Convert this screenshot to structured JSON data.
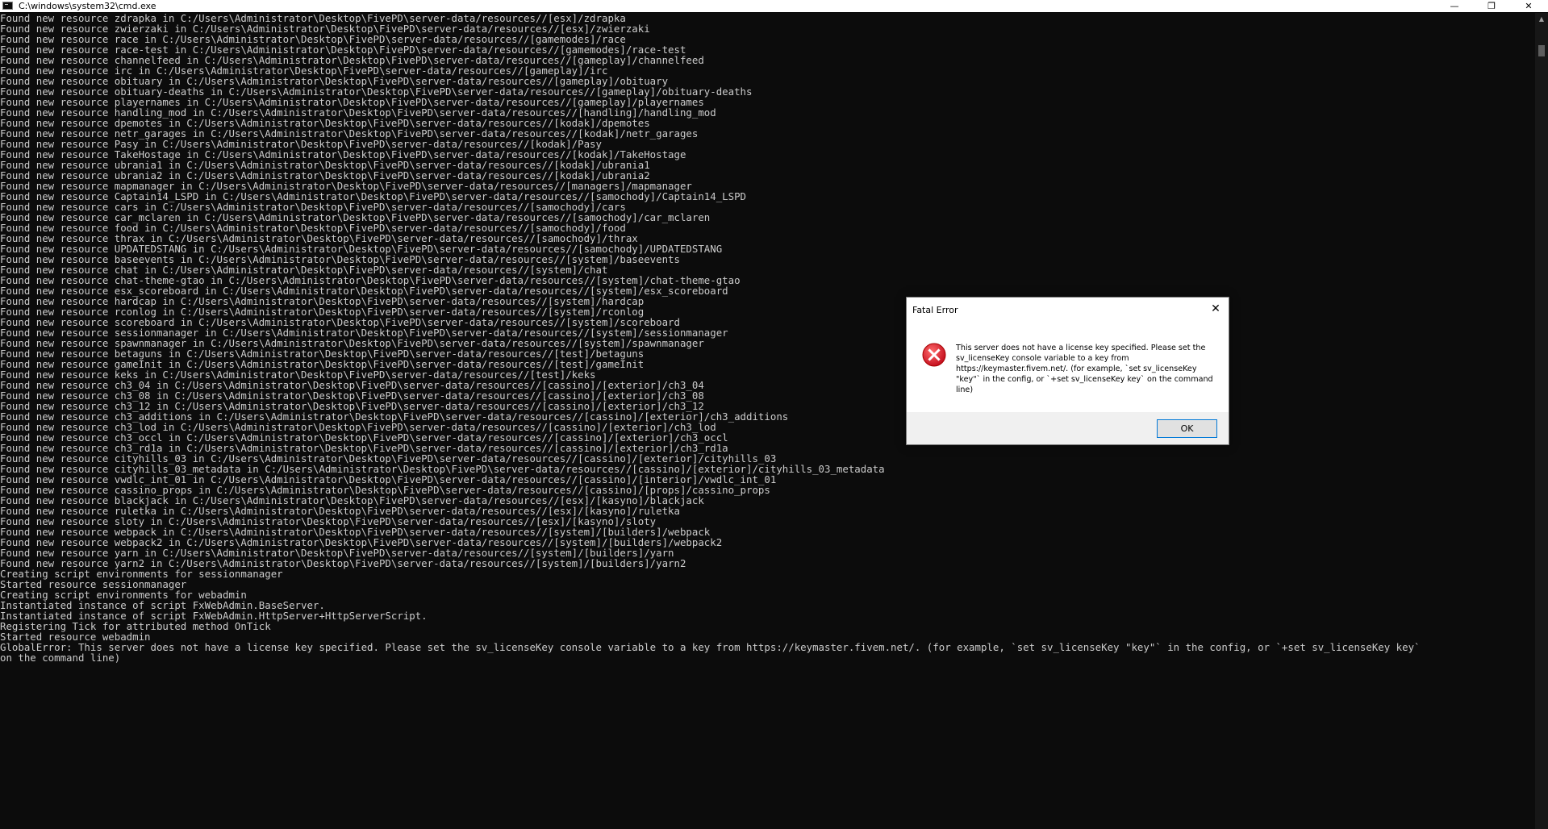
{
  "window": {
    "title": "C:\\windows\\system32\\cmd.exe",
    "minimize_glyph": "—",
    "maximize_glyph": "❐",
    "close_glyph": "✕",
    "background": "#0c0c0c",
    "text_color": "#cccccc"
  },
  "console": {
    "lines": [
      "Found new resource zdrapka in C:/Users\\Administrator\\Desktop\\FivePD\\server-data/resources//[esx]/zdrapka",
      "Found new resource zwierzaki in C:/Users\\Administrator\\Desktop\\FivePD\\server-data/resources//[esx]/zwierzaki",
      "Found new resource race in C:/Users\\Administrator\\Desktop\\FivePD\\server-data/resources//[gamemodes]/race",
      "Found new resource race-test in C:/Users\\Administrator\\Desktop\\FivePD\\server-data/resources//[gamemodes]/race-test",
      "Found new resource channelfeed in C:/Users\\Administrator\\Desktop\\FivePD\\server-data/resources//[gameplay]/channelfeed",
      "Found new resource irc in C:/Users\\Administrator\\Desktop\\FivePD\\server-data/resources//[gameplay]/irc",
      "Found new resource obituary in C:/Users\\Administrator\\Desktop\\FivePD\\server-data/resources//[gameplay]/obituary",
      "Found new resource obituary-deaths in C:/Users\\Administrator\\Desktop\\FivePD\\server-data/resources//[gameplay]/obituary-deaths",
      "Found new resource playernames in C:/Users\\Administrator\\Desktop\\FivePD\\server-data/resources//[gameplay]/playernames",
      "Found new resource handling_mod in C:/Users\\Administrator\\Desktop\\FivePD\\server-data/resources//[handling]/handling_mod",
      "Found new resource dpemotes in C:/Users\\Administrator\\Desktop\\FivePD\\server-data/resources//[kodak]/dpemotes",
      "Found new resource netr_garages in C:/Users\\Administrator\\Desktop\\FivePD\\server-data/resources//[kodak]/netr_garages",
      "Found new resource Pasy in C:/Users\\Administrator\\Desktop\\FivePD\\server-data/resources//[kodak]/Pasy",
      "Found new resource TakeHostage in C:/Users\\Administrator\\Desktop\\FivePD\\server-data/resources//[kodak]/TakeHostage",
      "Found new resource ubrania1 in C:/Users\\Administrator\\Desktop\\FivePD\\server-data/resources//[kodak]/ubrania1",
      "Found new resource ubrania2 in C:/Users\\Administrator\\Desktop\\FivePD\\server-data/resources//[kodak]/ubrania2",
      "Found new resource mapmanager in C:/Users\\Administrator\\Desktop\\FivePD\\server-data/resources//[managers]/mapmanager",
      "Found new resource Captain14_LSPD in C:/Users\\Administrator\\Desktop\\FivePD\\server-data/resources//[samochody]/Captain14_LSPD",
      "Found new resource cars in C:/Users\\Administrator\\Desktop\\FivePD\\server-data/resources//[samochody]/cars",
      "Found new resource car_mclaren in C:/Users\\Administrator\\Desktop\\FivePD\\server-data/resources//[samochody]/car_mclaren",
      "Found new resource food in C:/Users\\Administrator\\Desktop\\FivePD\\server-data/resources//[samochody]/food",
      "Found new resource thrax in C:/Users\\Administrator\\Desktop\\FivePD\\server-data/resources//[samochody]/thrax",
      "Found new resource UPDATEDSTANG in C:/Users\\Administrator\\Desktop\\FivePD\\server-data/resources//[samochody]/UPDATEDSTANG",
      "Found new resource baseevents in C:/Users\\Administrator\\Desktop\\FivePD\\server-data/resources//[system]/baseevents",
      "Found new resource chat in C:/Users\\Administrator\\Desktop\\FivePD\\server-data/resources//[system]/chat",
      "Found new resource chat-theme-gtao in C:/Users\\Administrator\\Desktop\\FivePD\\server-data/resources//[system]/chat-theme-gtao",
      "Found new resource esx_scoreboard in C:/Users\\Administrator\\Desktop\\FivePD\\server-data/resources//[system]/esx_scoreboard",
      "Found new resource hardcap in C:/Users\\Administrator\\Desktop\\FivePD\\server-data/resources//[system]/hardcap",
      "Found new resource rconlog in C:/Users\\Administrator\\Desktop\\FivePD\\server-data/resources//[system]/rconlog",
      "Found new resource scoreboard in C:/Users\\Administrator\\Desktop\\FivePD\\server-data/resources//[system]/scoreboard",
      "Found new resource sessionmanager in C:/Users\\Administrator\\Desktop\\FivePD\\server-data/resources//[system]/sessionmanager",
      "Found new resource spawnmanager in C:/Users\\Administrator\\Desktop\\FivePD\\server-data/resources//[system]/spawnmanager",
      "Found new resource betaguns in C:/Users\\Administrator\\Desktop\\FivePD\\server-data/resources//[test]/betaguns",
      "Found new resource gameInit in C:/Users\\Administrator\\Desktop\\FivePD\\server-data/resources//[test]/gameInit",
      "Found new resource keks in C:/Users\\Administrator\\Desktop\\FivePD\\server-data/resources//[test]/keks",
      "Found new resource ch3_04 in C:/Users\\Administrator\\Desktop\\FivePD\\server-data/resources//[cassino]/[exterior]/ch3_04",
      "Found new resource ch3_08 in C:/Users\\Administrator\\Desktop\\FivePD\\server-data/resources//[cassino]/[exterior]/ch3_08",
      "Found new resource ch3_12 in C:/Users\\Administrator\\Desktop\\FivePD\\server-data/resources//[cassino]/[exterior]/ch3_12",
      "Found new resource ch3_additions in C:/Users\\Administrator\\Desktop\\FivePD\\server-data/resources//[cassino]/[exterior]/ch3_additions",
      "Found new resource ch3_lod in C:/Users\\Administrator\\Desktop\\FivePD\\server-data/resources//[cassino]/[exterior]/ch3_lod",
      "Found new resource ch3_occl in C:/Users\\Administrator\\Desktop\\FivePD\\server-data/resources//[cassino]/[exterior]/ch3_occl",
      "Found new resource ch3_rd1a in C:/Users\\Administrator\\Desktop\\FivePD\\server-data/resources//[cassino]/[exterior]/ch3_rd1a",
      "Found new resource cityhills_03 in C:/Users\\Administrator\\Desktop\\FivePD\\server-data/resources//[cassino]/[exterior]/cityhills_03",
      "Found new resource cityhills_03_metadata in C:/Users\\Administrator\\Desktop\\FivePD\\server-data/resources//[cassino]/[exterior]/cityhills_03_metadata",
      "Found new resource vwdlc_int_01 in C:/Users\\Administrator\\Desktop\\FivePD\\server-data/resources//[cassino]/[interior]/vwdlc_int_01",
      "Found new resource cassino_props in C:/Users\\Administrator\\Desktop\\FivePD\\server-data/resources//[cassino]/[props]/cassino_props",
      "Found new resource blackjack in C:/Users\\Administrator\\Desktop\\FivePD\\server-data/resources//[esx]/[kasyno]/blackjack",
      "Found new resource ruletka in C:/Users\\Administrator\\Desktop\\FivePD\\server-data/resources//[esx]/[kasyno]/ruletka",
      "Found new resource sloty in C:/Users\\Administrator\\Desktop\\FivePD\\server-data/resources//[esx]/[kasyno]/sloty",
      "Found new resource webpack in C:/Users\\Administrator\\Desktop\\FivePD\\server-data/resources//[system]/[builders]/webpack",
      "Found new resource webpack2 in C:/Users\\Administrator\\Desktop\\FivePD\\server-data/resources//[system]/[builders]/webpack2",
      "Found new resource yarn in C:/Users\\Administrator\\Desktop\\FivePD\\server-data/resources//[system]/[builders]/yarn",
      "Found new resource yarn2 in C:/Users\\Administrator\\Desktop\\FivePD\\server-data/resources//[system]/[builders]/yarn2",
      "Creating script environments for sessionmanager",
      "Started resource sessionmanager",
      "Creating script environments for webadmin",
      "Instantiated instance of script FxWebAdmin.BaseServer.",
      "Instantiated instance of script FxWebAdmin.HttpServer+HttpServerScript.",
      "Registering Tick for attributed method OnTick",
      "Started resource webadmin",
      "GlobalError: This server does not have a license key specified. Please set the sv_licenseKey console variable to a key from https://keymaster.fivem.net/. (for example, `set sv_licenseKey \"key\"` in the config, or `+set sv_licenseKey key`",
      "on the command line)"
    ]
  },
  "dialog": {
    "title": "Fatal Error",
    "close_glyph": "✕",
    "message": "This server does not have a license key specified. Please set the sv_licenseKey console variable to a key from https://keymaster.fivem.net/. (for example, `set sv_licenseKey \"key\"` in the config, or `+set sv_licenseKey key` on the command line)",
    "ok_label": "OK",
    "icon": "error-icon",
    "icon_color": "#e81123",
    "button_border": "#0078d7"
  }
}
